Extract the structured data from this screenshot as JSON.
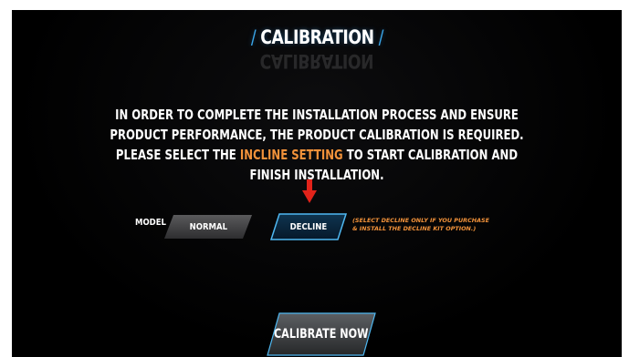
{
  "header": {
    "title": "CALIBRATION"
  },
  "message": {
    "line1": "IN ORDER TO COMPLETE THE INSTALLATION PROCESS AND ENSURE",
    "line2": "PRODUCT PERFORMANCE, THE PRODUCT CALIBRATION IS REQUIRED.",
    "line3_before": "PLEASE SELECT THE ",
    "line3_highlight": "INCLINE SETTING",
    "line3_after": " TO START CALIBRATION AND",
    "line4": "FINISH INSTALLATION."
  },
  "model": {
    "label": "MODEL",
    "options": [
      "NORMAL",
      "DECLINE"
    ],
    "selected": "DECLINE",
    "note_line1": "(SELECT DECLINE ONLY IF YOU PURCHASE",
    "note_line2": "& INSTALL THE DECLINE KIT OPTION.)"
  },
  "actions": {
    "calibrate_label": "CALIBRATE NOW"
  },
  "colors": {
    "background": "#000000",
    "accent_blue": "#3aa5e8",
    "highlight_orange": "#f2923a",
    "arrow_red": "#e2231a"
  },
  "icons": {
    "pointer": "arrow-down-icon"
  }
}
